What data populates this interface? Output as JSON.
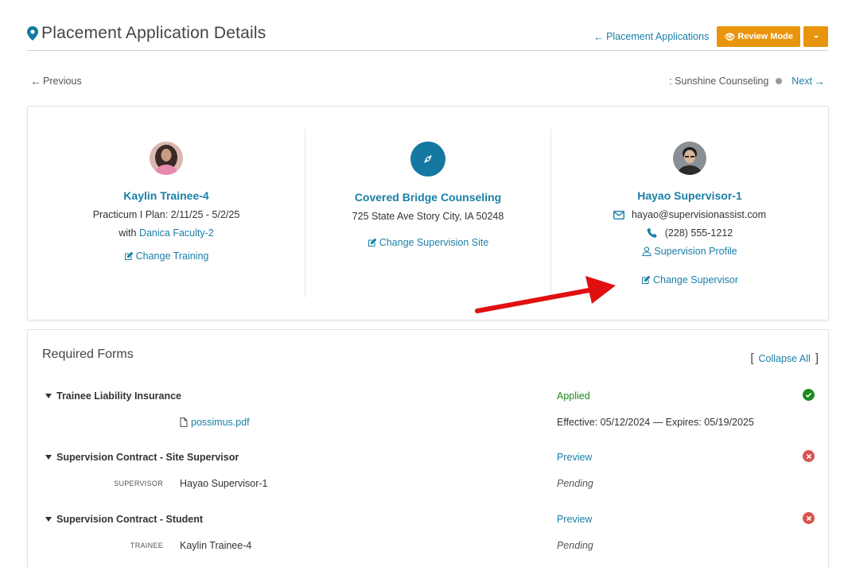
{
  "header": {
    "title": "Placement Application Details",
    "back_link": "Placement Applications",
    "review_button": "Review Mode"
  },
  "nav": {
    "previous": "Previous",
    "next_site": ": Sunshine Counseling",
    "next": "Next"
  },
  "trainee": {
    "name": "Kaylin Trainee-4",
    "plan": "Practicum I Plan: 2/11/25 - 5/2/25",
    "with_label": "with",
    "faculty": "Danica Faculty-2",
    "action": "Change Training"
  },
  "site": {
    "name": "Covered Bridge Counseling",
    "address": "725 State Ave Story City, IA 50248",
    "action": "Change Supervision Site"
  },
  "supervisor": {
    "name": "Hayao Supervisor-1",
    "email": "hayao@supervisionassist.com",
    "phone": "(228) 555-1212",
    "profile": "Supervision Profile",
    "action": "Change Supervisor"
  },
  "forms": {
    "title": "Required Forms",
    "collapse_all": "Collapse All",
    "items": [
      {
        "title": "Trainee Liability Insurance",
        "status": "Applied",
        "file": "possimus.pdf",
        "dates": "Effective: 05/12/2024 — Expires: 05/19/2025"
      },
      {
        "title": "Supervision Contract - Site Supervisor",
        "status": "Preview",
        "role": "Supervisor",
        "person": "Hayao Supervisor-1",
        "sub_status": "Pending"
      },
      {
        "title": "Supervision Contract - Student",
        "status": "Preview",
        "role": "Trainee",
        "person": "Kaylin Trainee-4",
        "sub_status": "Pending"
      }
    ]
  },
  "colors": {
    "accent": "#1a7fa8",
    "orange": "#e8950d",
    "success": "#1f8a1f",
    "error": "#d9534f",
    "annotation_arrow": "#e01010"
  }
}
